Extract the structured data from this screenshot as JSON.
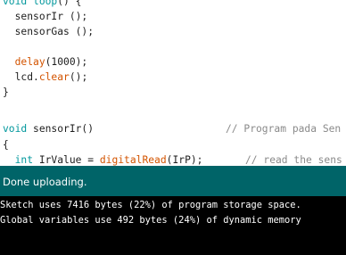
{
  "editor": {
    "lines": {
      "loop_sig": {
        "ret": "void",
        "fn": "loop",
        "rest": "() {"
      },
      "call_ir": "sensorIr ();",
      "call_gas": "sensorGas ();",
      "delay": {
        "fn": "delay",
        "rest": "(1000);"
      },
      "lcd": {
        "obj": "lcd.",
        "fn": "clear",
        "rest": "();"
      },
      "close": "}",
      "sensor_sig": {
        "ret": "void",
        "rest": " sensorIr()",
        "comment": "// Program pada Sen"
      },
      "open": "{",
      "partial": {
        "type": "int",
        "mid": " IrValue = ",
        "fn": "digitalRead",
        "arg": "(IrP);",
        "comment": "// read the sens"
      }
    }
  },
  "status": {
    "message": "Done uploading."
  },
  "console": {
    "lines": [
      "Sketch uses 7416 bytes (22%) of program storage space.",
      "Global variables use 492 bytes (24%) of dynamic memory"
    ]
  }
}
